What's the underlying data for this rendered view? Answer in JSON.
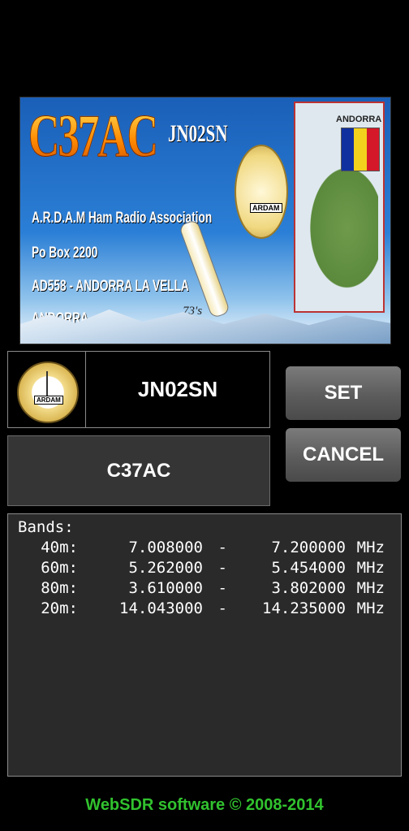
{
  "qsl_card": {
    "callsign": "C37AC",
    "locator": "JN02SN",
    "line1": "A.R.D.A.M Ham Radio Association",
    "line2": "Po Box 2200",
    "line3": "AD558 - ANDORRA LA VELLA",
    "line4": "ANDORRA",
    "map_label": "ANDORRA",
    "seal_label": "ARDAM",
    "signature": "73's",
    "flag_colors": [
      "#1030a0",
      "#f2d21c",
      "#d4182a"
    ]
  },
  "station": {
    "logo_label": "ARDAM",
    "locator": "JN02SN",
    "callsign": "C37AC"
  },
  "buttons": {
    "set": "SET",
    "cancel": "CANCEL"
  },
  "bands": {
    "title": "Bands:",
    "rows": [
      {
        "band": "40m:",
        "low": "7.008000",
        "dash": "-",
        "high": "7.200000",
        "unit": "MHz"
      },
      {
        "band": "60m:",
        "low": "5.262000",
        "dash": "-",
        "high": "5.454000",
        "unit": "MHz"
      },
      {
        "band": "80m:",
        "low": "3.610000",
        "dash": "-",
        "high": "3.802000",
        "unit": "MHz"
      },
      {
        "band": "20m:",
        "low": "14.043000",
        "dash": "-",
        "high": "14.235000",
        "unit": "MHz"
      }
    ]
  },
  "footer": "WebSDR software © 2008-2014"
}
